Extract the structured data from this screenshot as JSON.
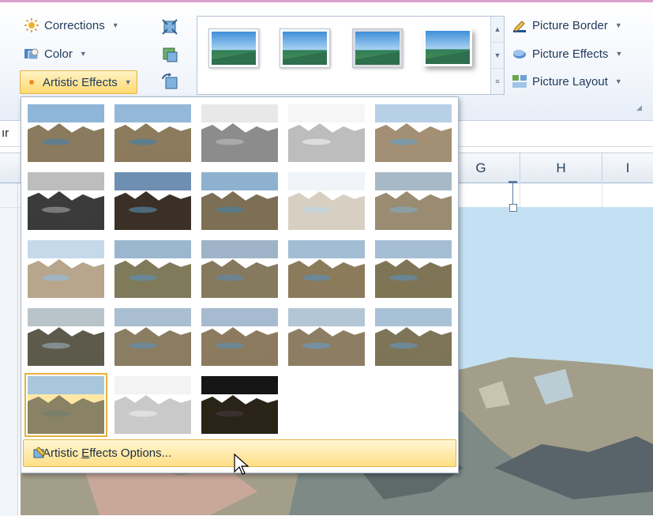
{
  "ribbon": {
    "corrections_label": "Corrections",
    "color_label": "Color",
    "artistic_effects_label": "Artistic Effects",
    "picture_border_label": "Picture Border",
    "picture_effects_label": "Picture Effects",
    "picture_layout_label": "Picture Layout",
    "style_thumbnails": [
      {
        "name": "picture-style-1",
        "selected": false
      },
      {
        "name": "picture-style-2",
        "selected": false
      },
      {
        "name": "picture-style-3",
        "selected": true
      },
      {
        "name": "picture-style-4",
        "selected": false
      }
    ]
  },
  "sheet": {
    "formula_fragment": "ır",
    "columns": [
      "G",
      "H",
      "I"
    ]
  },
  "menu": {
    "effects": [
      {
        "name": "none",
        "sky": "#8fb6d9",
        "land": "#8a7a5e",
        "lake": "#5f7f8f"
      },
      {
        "name": "marker",
        "sky": "#94b8d8",
        "land": "#8c7b5c",
        "lake": "#5d7e8c"
      },
      {
        "name": "pencil-grayscale",
        "sky": "#e8e8e8",
        "land": "#8c8c8c",
        "lake": "#aaaaaa"
      },
      {
        "name": "pencil-sketch",
        "sky": "#f6f6f6",
        "land": "#bdbdbd",
        "lake": "#dddddd"
      },
      {
        "name": "line-drawing",
        "sky": "#b8d0e6",
        "land": "#a38f73",
        "lake": "#7d9aa6"
      },
      {
        "name": "chalk-sketch",
        "sky": "#bdbdbd",
        "land": "#3b3b3b",
        "lake": "#7a7a7a"
      },
      {
        "name": "paint-strokes",
        "sky": "#6e8fb2",
        "land": "#3a3026",
        "lake": "#4d6a7a"
      },
      {
        "name": "paint-brush",
        "sky": "#8fb1d0",
        "land": "#7d6f55",
        "lake": "#5b7a87"
      },
      {
        "name": "glow-diffused",
        "sky": "#f0f4f8",
        "land": "#d7d0c2",
        "lake": "#c6d4da"
      },
      {
        "name": "blur",
        "sky": "#a7b9c6",
        "land": "#9a8c72",
        "lake": "#8b9ea6"
      },
      {
        "name": "light-screen",
        "sky": "#c6d9ea",
        "land": "#b7a68c",
        "lake": "#9fb5c2"
      },
      {
        "name": "watercolor-sponge",
        "sky": "#9bb7cf",
        "land": "#7f7a5a",
        "lake": "#6a8795"
      },
      {
        "name": "film-grain",
        "sky": "#9fb4c8",
        "land": "#857a5e",
        "lake": "#6c8491"
      },
      {
        "name": "mosaic-bubbles",
        "sky": "#a3bdd4",
        "land": "#8b7b5b",
        "lake": "#6b8896"
      },
      {
        "name": "glass",
        "sky": "#a5bed3",
        "land": "#7f7556",
        "lake": "#6a8592"
      },
      {
        "name": "cement",
        "sky": "#b9c3ca",
        "land": "#5d5a4c",
        "lake": "#838c8e"
      },
      {
        "name": "texturizer",
        "sky": "#a9bfd1",
        "land": "#8a7d61",
        "lake": "#6f8896"
      },
      {
        "name": "crisscross-etching",
        "sky": "#a6bbcf",
        "land": "#8c7b5e",
        "lake": "#6d8794"
      },
      {
        "name": "pastels-smooth",
        "sky": "#b3c6d6",
        "land": "#8d7e63",
        "lake": "#7690a0"
      },
      {
        "name": "plastic-wrap",
        "sky": "#a9c1d6",
        "land": "#7e7457",
        "lake": "#6e8896"
      },
      {
        "name": "cutout",
        "sky": "#a8c7dd",
        "land": "#8a8264",
        "lake": "#7a7f6a"
      },
      {
        "name": "photocopy",
        "sky": "#f3f3f3",
        "land": "#c9c9c9",
        "lake": "#e0e0e0"
      },
      {
        "name": "glow-edges",
        "sky": "#151515",
        "land": "#2a2418",
        "lake": "#3a3030"
      }
    ],
    "selected_effect_index": 20,
    "options_label_before": "Artistic ",
    "options_label_accel": "E",
    "options_label_after": "ffects Options..."
  }
}
